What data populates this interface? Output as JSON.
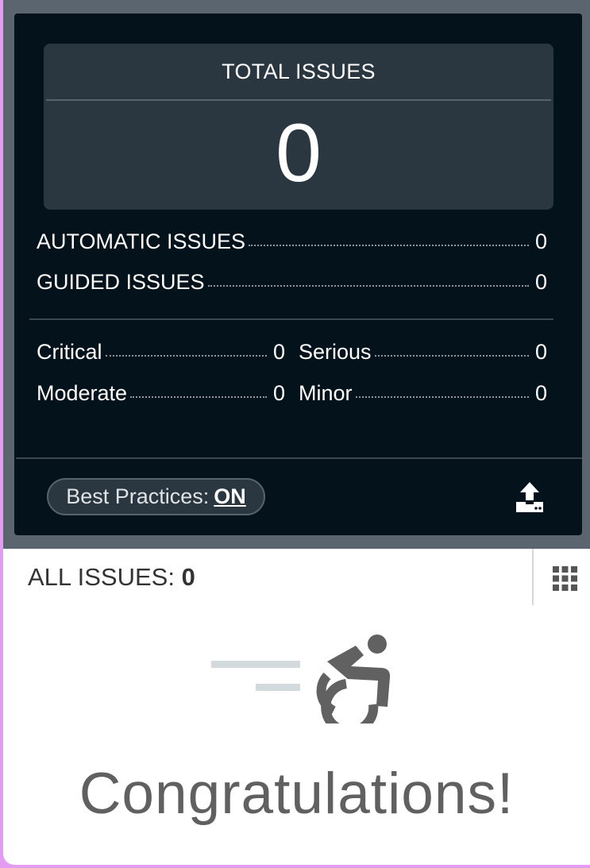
{
  "summary": {
    "total_title": "TOTAL ISSUES",
    "total_value": "0",
    "automatic_label": "AUTOMATIC ISSUES",
    "automatic_value": "0",
    "guided_label": "GUIDED ISSUES",
    "guided_value": "0",
    "severity": {
      "critical_label": "Critical",
      "critical_value": "0",
      "serious_label": "Serious",
      "serious_value": "0",
      "moderate_label": "Moderate",
      "moderate_value": "0",
      "minor_label": "Minor",
      "minor_value": "0"
    },
    "best_practices_label": "Best Practices:",
    "best_practices_state": "ON"
  },
  "issues_header": {
    "label": "ALL ISSUES:",
    "count": "0"
  },
  "empty_state": {
    "message": "Congratulations!",
    "icon": "accessibility-wheelchair-icon"
  },
  "icons": {
    "export": "export-upload-icon",
    "grid": "grid-view-icon"
  },
  "colors": {
    "panel_bg": "#04121b",
    "box_bg": "#2b3740",
    "outer_bg": "#5a6570",
    "accent_pink": "#e39cf2"
  }
}
